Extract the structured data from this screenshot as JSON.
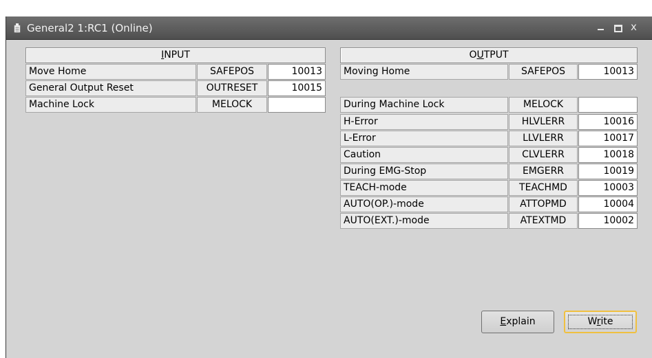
{
  "window": {
    "title": "General2 1:RC1 (Online)",
    "icons": [
      "doc-icon",
      "minimize-icon",
      "maximize-icon",
      "close-icon"
    ],
    "close_glyph": "x"
  },
  "input": {
    "header_pre": "",
    "header_hot": "I",
    "header_post": "NPUT",
    "rows": [
      {
        "label": "Move Home",
        "signal": "SAFEPOS",
        "value": "10013"
      },
      {
        "label": "General Output Reset",
        "signal": "OUTRESET",
        "value": "10015"
      },
      {
        "label": "Machine Lock",
        "signal": "MELOCK",
        "value": ""
      }
    ]
  },
  "output": {
    "header_pre": "O",
    "header_hot": "U",
    "header_post": "TPUT",
    "rows": [
      {
        "label": "Moving Home",
        "signal": "SAFEPOS",
        "value": "10013"
      },
      {
        "label": "During Machine Lock",
        "signal": "MELOCK",
        "value": ""
      },
      {
        "label": "H-Error",
        "signal": "HLVLERR",
        "value": "10016"
      },
      {
        "label": "L-Error",
        "signal": "LLVLERR",
        "value": "10017"
      },
      {
        "label": "Caution",
        "signal": "CLVLERR",
        "value": "10018"
      },
      {
        "label": "During EMG-Stop",
        "signal": "EMGERR",
        "value": "10019"
      },
      {
        "label": "TEACH-mode",
        "signal": "TEACHMD",
        "value": "10003"
      },
      {
        "label": "AUTO(OP.)-mode",
        "signal": "ATTOPMD",
        "value": "10004"
      },
      {
        "label": "AUTO(EXT.)-mode",
        "signal": "ATEXTMD",
        "value": "10002"
      }
    ]
  },
  "buttons": {
    "explain": {
      "hot": "E",
      "rest": "xplain"
    },
    "write": {
      "pre": "W",
      "hot": "r",
      "post": "ite"
    }
  }
}
